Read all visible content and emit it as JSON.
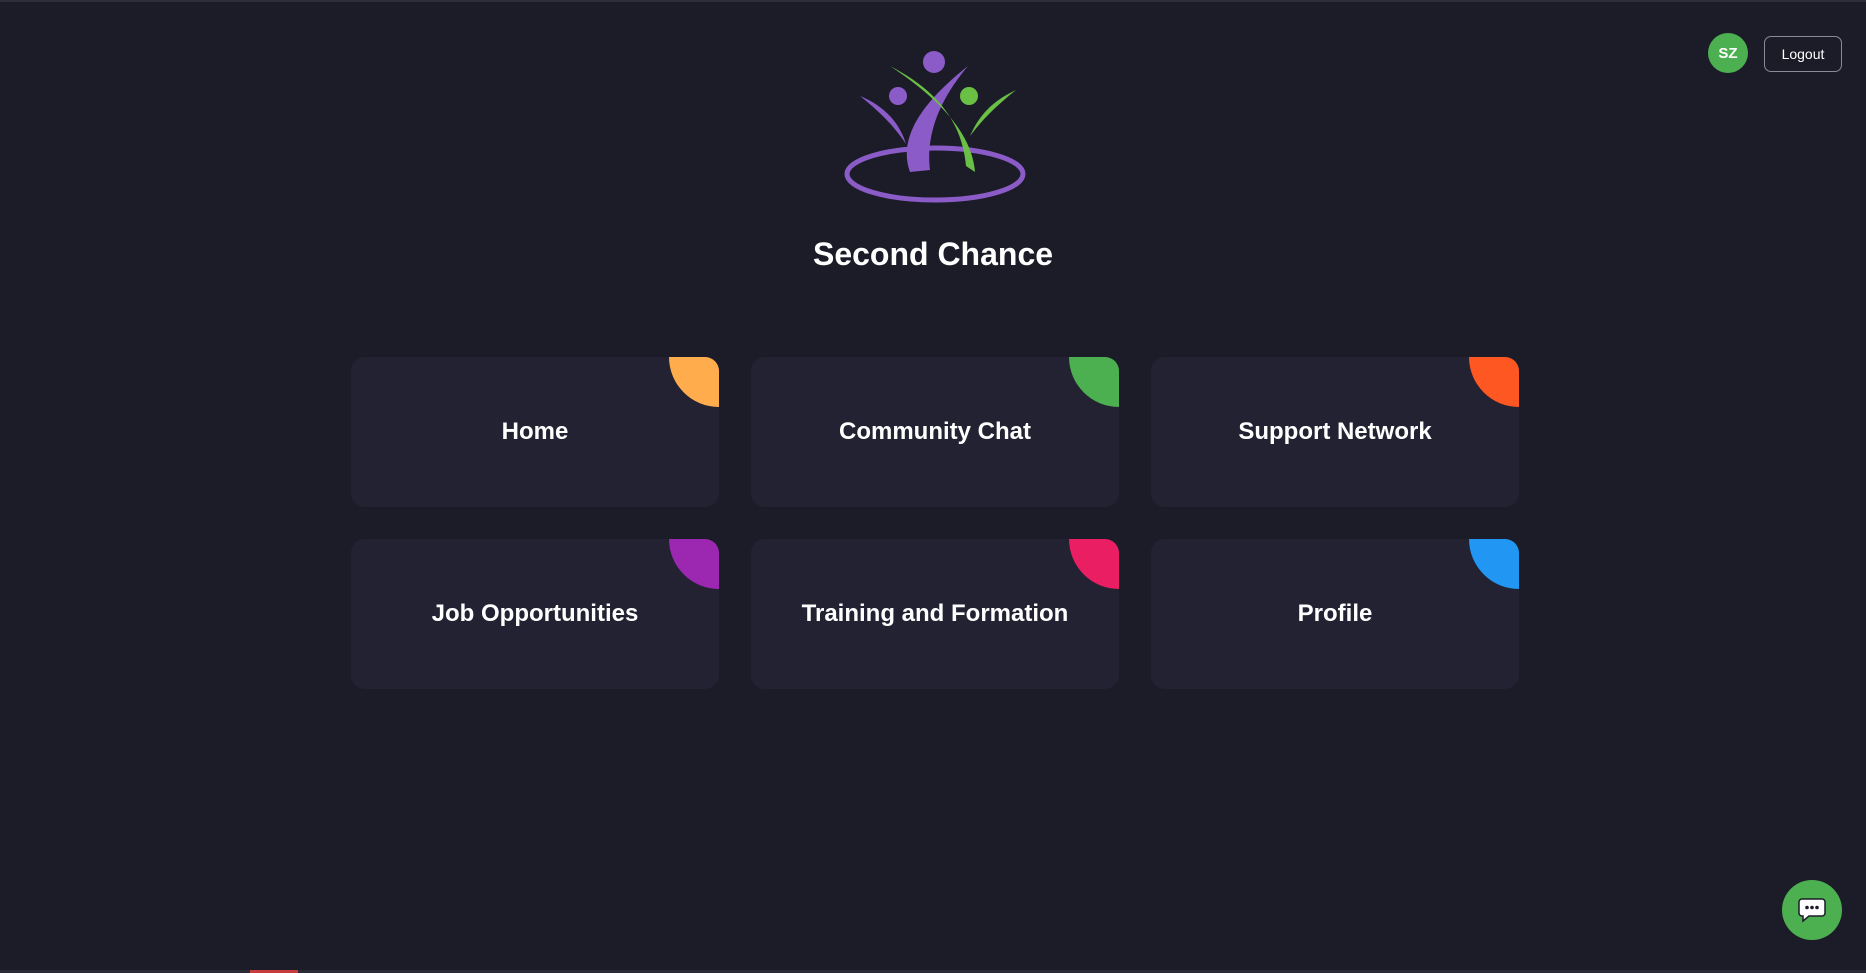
{
  "header": {
    "avatar_initials": "SZ",
    "logout_label": "Logout"
  },
  "app": {
    "title": "Second Chance"
  },
  "cards": [
    {
      "label": "Home",
      "accent": "#ffac4d"
    },
    {
      "label": "Community Chat",
      "accent": "#4caf50"
    },
    {
      "label": "Support Network",
      "accent": "#ff5722"
    },
    {
      "label": "Job Opportunities",
      "accent": "#9c27b0"
    },
    {
      "label": "Training and Formation",
      "accent": "#e91e63"
    },
    {
      "label": "Profile",
      "accent": "#2196f3"
    }
  ],
  "colors": {
    "background": "#1c1c29",
    "card": "#222233",
    "avatar": "#4caf50",
    "chat_button": "#4caf50",
    "logo_purple": "#8b5cc8",
    "logo_green": "#6abf45"
  },
  "icons": {
    "chat_button": "chat-bubble-icon",
    "logo": "people-logo-icon"
  }
}
